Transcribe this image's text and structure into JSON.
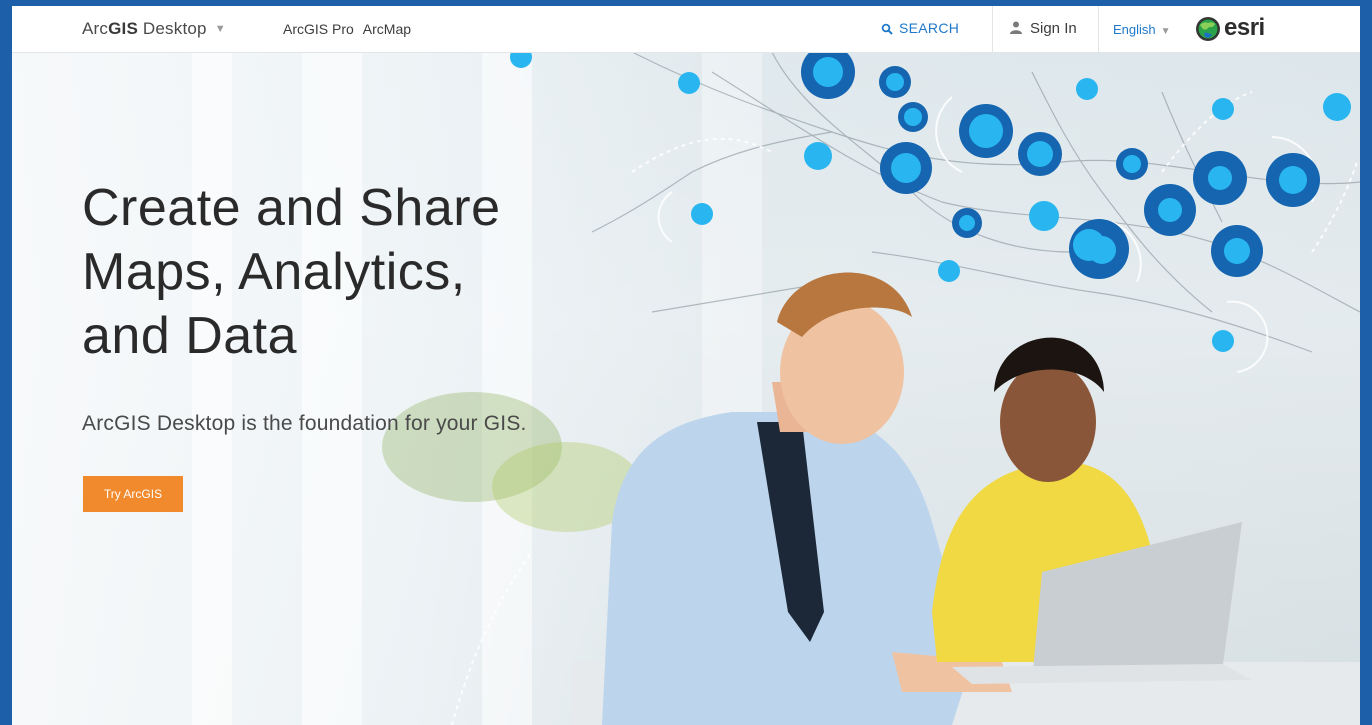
{
  "nav": {
    "brand_prefix": "Arc",
    "brand_bold": "GIS",
    "brand_suffix": " Desktop",
    "links": [
      "ArcGIS Pro",
      "ArcMap"
    ],
    "search_label": "SEARCH",
    "signin_label": "Sign In",
    "language_label": "English",
    "logo_text": "esri"
  },
  "hero": {
    "headline_lines": [
      "Create and Share",
      "Maps, Analytics,",
      "and Data"
    ],
    "subhead": "ArcGIS Desktop is the foundation for your GIS.",
    "cta_label": "Try ArcGIS"
  },
  "colors": {
    "accent_blue": "#1f78c8",
    "cta_orange": "#f08a2c",
    "map_dot_light": "#29b6f0",
    "map_dot_dark": "#1565b0"
  },
  "icons": [
    "chevron-down-icon",
    "search-icon",
    "user-icon",
    "globe-icon"
  ]
}
